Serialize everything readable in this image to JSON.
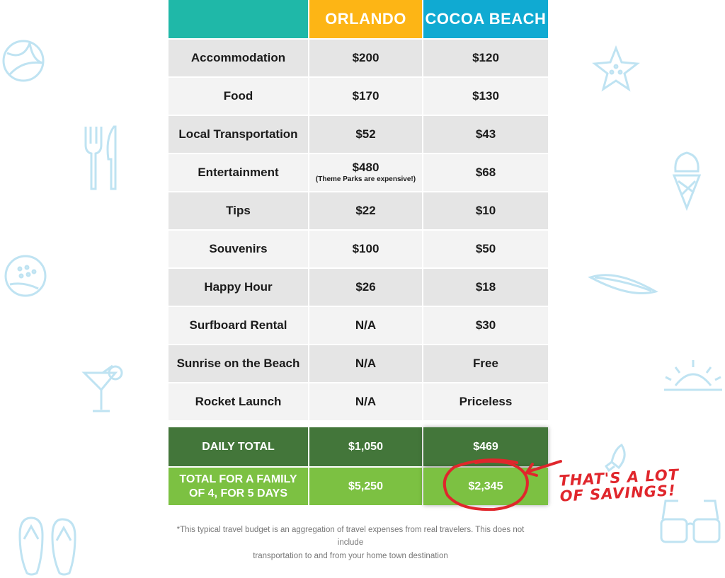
{
  "header": {
    "blank": "",
    "orlando": "ORLANDO",
    "cocoa": "COCOA BEACH"
  },
  "rows": [
    {
      "label": "Accommodation",
      "orlando": "$200",
      "cocoa": "$120"
    },
    {
      "label": "Food",
      "orlando": "$170",
      "cocoa": "$130"
    },
    {
      "label": "Local Transportation",
      "orlando": "$52",
      "cocoa": "$43"
    },
    {
      "label": "Entertainment",
      "orlando": "$480",
      "orlando_note": "(Theme Parks are expensive!)",
      "cocoa": "$68"
    },
    {
      "label": "Tips",
      "orlando": "$22",
      "cocoa": "$10"
    },
    {
      "label": "Souvenirs",
      "orlando": "$100",
      "cocoa": "$50"
    },
    {
      "label": "Happy Hour",
      "orlando": "$26",
      "cocoa": "$18"
    },
    {
      "label": "Surfboard Rental",
      "orlando": "N/A",
      "cocoa": "$30"
    },
    {
      "label": "Sunrise on the Beach",
      "orlando": "N/A",
      "cocoa": "Free"
    },
    {
      "label": "Rocket Launch",
      "orlando": "N/A",
      "cocoa": "Priceless"
    }
  ],
  "totals": {
    "daily": {
      "label": "DAILY TOTAL",
      "orlando": "$1,050",
      "cocoa": "$469"
    },
    "family": {
      "label_line1": "TOTAL FOR A FAMILY",
      "label_line2": "OF 4, FOR 5 DAYS",
      "orlando": "$5,250",
      "cocoa": "$2,345"
    }
  },
  "callout": {
    "line1": "THAT'S A LOT",
    "line2": "OF SAVINGS!"
  },
  "footnote": {
    "line1": "*This typical travel budget is an aggregation of travel expenses from real travelers. This does not include",
    "line2": "transportation to and from your home town destination"
  },
  "colors": {
    "teal": "#1fb8a8",
    "orange": "#fdb515",
    "blue": "#10aad2",
    "dark_green": "#43763a",
    "light_green": "#7cc142",
    "red": "#e0262c",
    "icon_blue": "#bfe3f2"
  },
  "decor_icons": [
    "beach-ball-icon",
    "fork-knife-icon",
    "golf-ball-icon",
    "cocktail-icon",
    "flip-flops-icon",
    "starfish-icon",
    "ice-cream-icon",
    "surfboard-icon",
    "sunset-icon",
    "rocket-icon",
    "sunglasses-icon"
  ]
}
